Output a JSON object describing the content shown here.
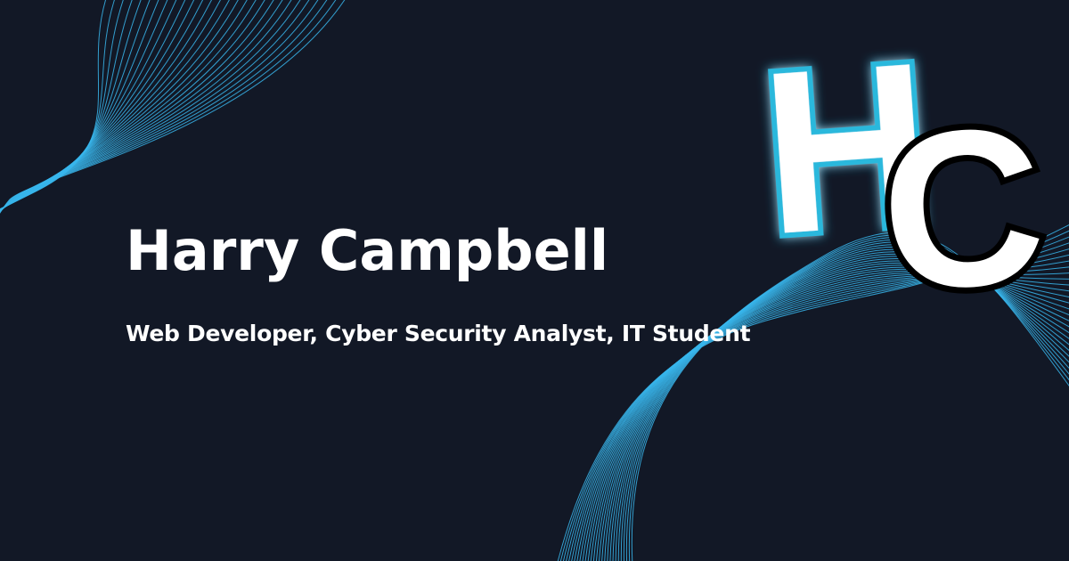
{
  "name": "Harry Campbell",
  "tagline": "Web Developer, Cyber Security Analyst, IT Student",
  "logo": {
    "letter_h": "H",
    "letter_c": "C"
  },
  "colors": {
    "background": "#121826",
    "wave": "#38b6ec",
    "text": "#ffffff",
    "logo_h_outline": "#2bb8dc",
    "logo_c_outline": "#000000"
  }
}
